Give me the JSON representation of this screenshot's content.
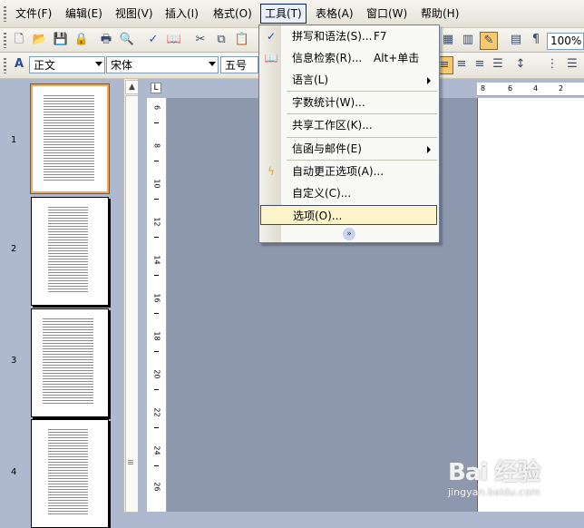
{
  "menubar": {
    "items": [
      {
        "label": "文件(F)"
      },
      {
        "label": "编辑(E)"
      },
      {
        "label": "视图(V)"
      },
      {
        "label": "插入(I)"
      },
      {
        "label": "格式(O)"
      },
      {
        "label": "工具(T)"
      },
      {
        "label": "表格(A)"
      },
      {
        "label": "窗口(W)"
      },
      {
        "label": "帮助(H)"
      }
    ]
  },
  "toolbar1": {
    "zoom": "100%"
  },
  "toolbar2": {
    "style": "正文",
    "font": "宋体",
    "size": "五号"
  },
  "tools_menu": {
    "items": [
      {
        "label": "拼写和语法(S)...",
        "shortcut": "F7"
      },
      {
        "label": "信息检索(R)...",
        "shortcut": "Alt+单击"
      },
      {
        "label": "语言(L)"
      },
      {
        "label": "字数统计(W)..."
      },
      {
        "label": "共享工作区(K)..."
      },
      {
        "label": "信函与邮件(E)"
      },
      {
        "label": "自动更正选项(A)..."
      },
      {
        "label": "自定义(C)..."
      },
      {
        "label": "选项(O)..."
      }
    ]
  },
  "thumbnails": {
    "pages": [
      "1",
      "2",
      "3",
      "4"
    ]
  },
  "vruler": {
    "labels": [
      "6",
      "8",
      "10",
      "12",
      "14",
      "16",
      "18",
      "20",
      "22",
      "24",
      "26"
    ]
  },
  "hruler": {
    "labels": [
      "8",
      "6",
      "4",
      "2"
    ]
  },
  "watermark": {
    "logo": "Bai 经验",
    "url": "jingyan.baidu.com"
  }
}
